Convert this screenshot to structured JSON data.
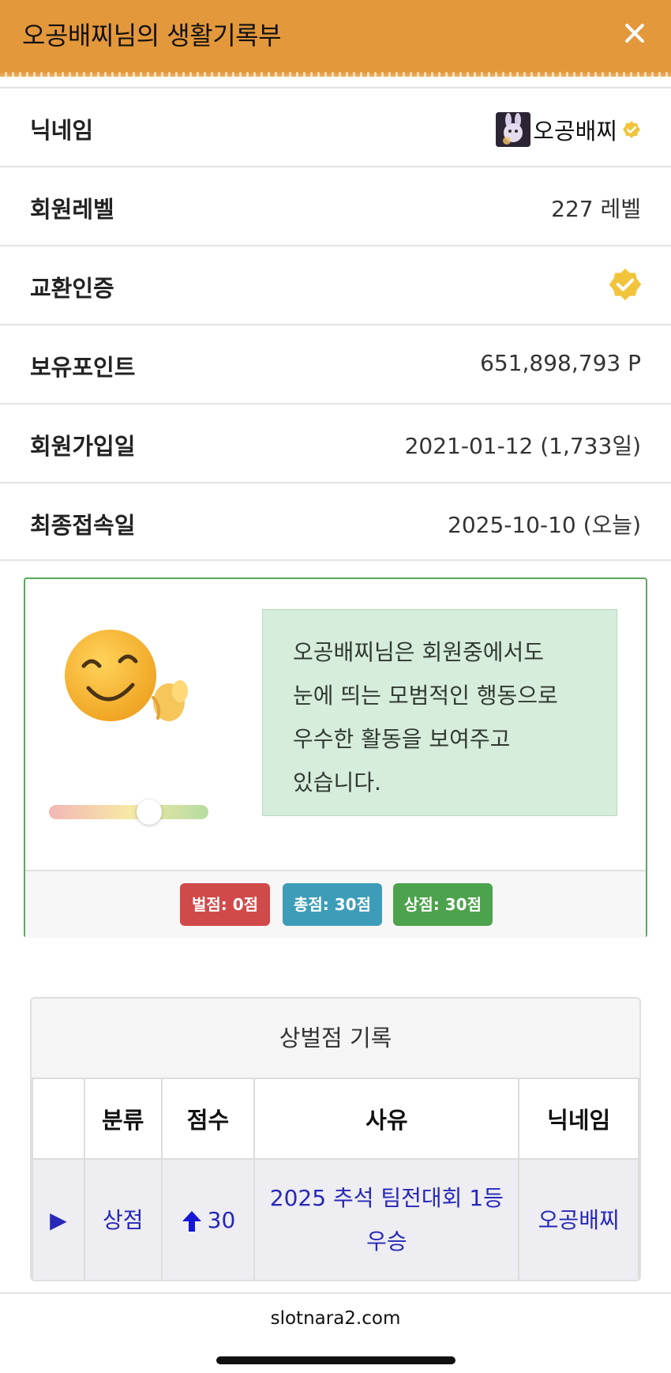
{
  "header": {
    "title": "오공배찌님의 생활기록부",
    "accent_color": "#e3983b",
    "close_icon": "close-icon"
  },
  "profile": {
    "nickname": {
      "label": "닉네임",
      "value": "오공배찌",
      "verified_icon": "verified-badge-icon"
    },
    "level": {
      "label": "회원레벨",
      "value": "227 레벨"
    },
    "exchange": {
      "label": "교환인증",
      "verified_icon": "verified-badge-icon"
    },
    "points": {
      "label": "보유포인트",
      "value": "651,898,793 P"
    },
    "joined": {
      "label": "회원가입일",
      "value": "2021-01-12 (1,733일)"
    },
    "last_login": {
      "label": "최종접속일",
      "value": "2025-10-10 (오늘)"
    }
  },
  "score_panel": {
    "face_icon": "smiling-face-icon",
    "slider_level": 0.63,
    "comment_lines": [
      "오공배찌님은 회원중에서도",
      "눈에 띄는 모범적인 행동으로",
      "우수한 활동을 보여주고",
      "있습니다."
    ],
    "penalty": "벌점: 0점",
    "total": "총점: 30점",
    "reward": "상점: 30점"
  },
  "records": {
    "title": "상벌점 기록",
    "columns": [
      "",
      "분류",
      "점수",
      "사유",
      "닉네임"
    ],
    "rows": [
      {
        "expand": "▶",
        "category": "상점",
        "score": "30",
        "reason_line1": "2025 추석 팀전대회 1등",
        "reason_line2": "우승",
        "nickname": "오공배찌"
      }
    ]
  },
  "footer": {
    "url": "slotnara2.com"
  }
}
